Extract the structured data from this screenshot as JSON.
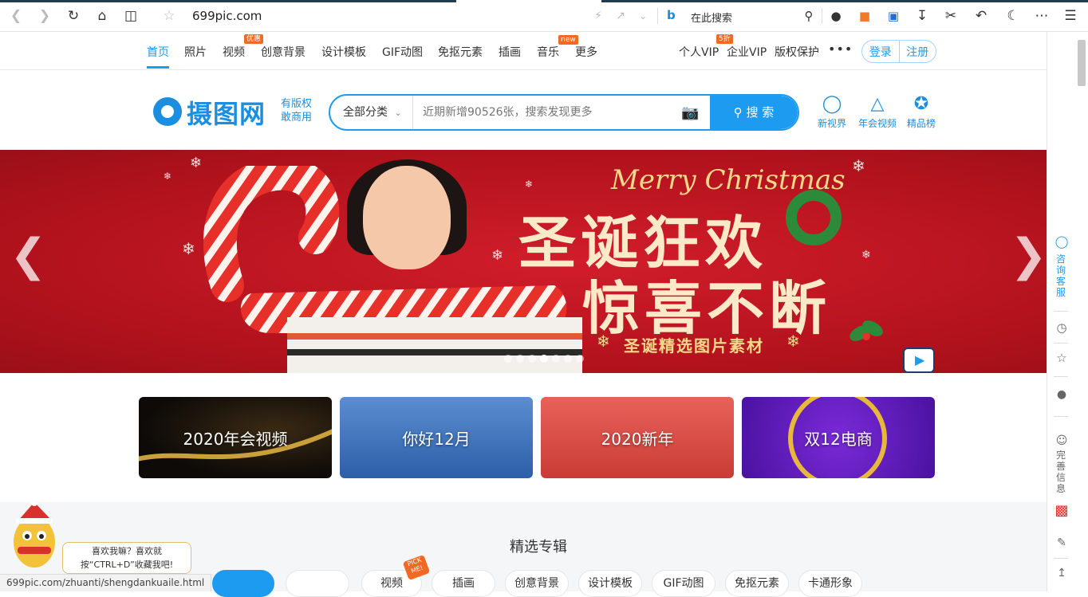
{
  "browser": {
    "url": "699pic.com",
    "search_placeholder": "在此搜索",
    "icons": [
      "back-icon",
      "forward-icon",
      "reload-icon",
      "home-icon",
      "reader-icon",
      "star-icon",
      "lightning-icon",
      "share-icon",
      "chevron-down-icon",
      "bing-icon",
      "search-icon",
      "lightbulb-icon",
      "gamepad-icon",
      "extension-icon",
      "download-icon",
      "scissors-icon",
      "undo-icon",
      "moon-icon",
      "more-icon",
      "menu-icon"
    ]
  },
  "nav": {
    "items": [
      "首页",
      "照片",
      "视频",
      "创意背景",
      "设计模板",
      "GIF动图",
      "免抠元素",
      "插画",
      "音乐",
      "更多"
    ],
    "badges": {
      "video": "优惠",
      "music": "new",
      "vip": "5折"
    },
    "right_items": [
      "个人VIP",
      "企业VIP",
      "版权保护"
    ],
    "more": "•••",
    "login": "登录",
    "register": "注册",
    "accent": "#1c9bf0"
  },
  "header": {
    "logo": "摄图网",
    "slogan": "有版权敢商用",
    "search_category": "全部分类",
    "search_placeholder": "近期新增90526张，搜索发现更多",
    "search_button": "搜 索",
    "links": [
      {
        "label": "新视界",
        "icon": "globe-icon"
      },
      {
        "label": "年会视频",
        "icon": "trophy-icon"
      },
      {
        "label": "精品榜",
        "icon": "medal-icon"
      }
    ]
  },
  "banner": {
    "merry": "Merry Christmas",
    "line1": "圣诞狂欢",
    "line2": "惊喜不断",
    "subtitle": "圣诞精选图片素材",
    "slide_count": 7,
    "active_slide": 4
  },
  "topics": [
    {
      "label": "2020年会视频",
      "bg": "#1a1410"
    },
    {
      "label": "你好12月",
      "bg": "#5b8fc9"
    },
    {
      "label": "2020新年",
      "bg": "#e0504a"
    },
    {
      "label": "双12电商",
      "bg": "#6a22c8"
    }
  ],
  "featured": {
    "title": "精选专辑",
    "pills": [
      "视频",
      "插画",
      "创意背景",
      "设计模板",
      "GIF动图",
      "免抠元素",
      "卡通形象"
    ],
    "pick_badge": "PICK ME!"
  },
  "sidebar": {
    "consult": "咨询客服",
    "profile": "完善信息",
    "icons": [
      "headset-icon",
      "clock-icon",
      "star-icon",
      "coins-icon",
      "user-icon",
      "gift-icon",
      "edit-icon",
      "top-icon"
    ]
  },
  "tooltip": "喜欢我嘛？喜欢就按“CTRL+D”收藏我吧!",
  "status_url": "699pic.com/zhuanti/shengdankuaile.html"
}
